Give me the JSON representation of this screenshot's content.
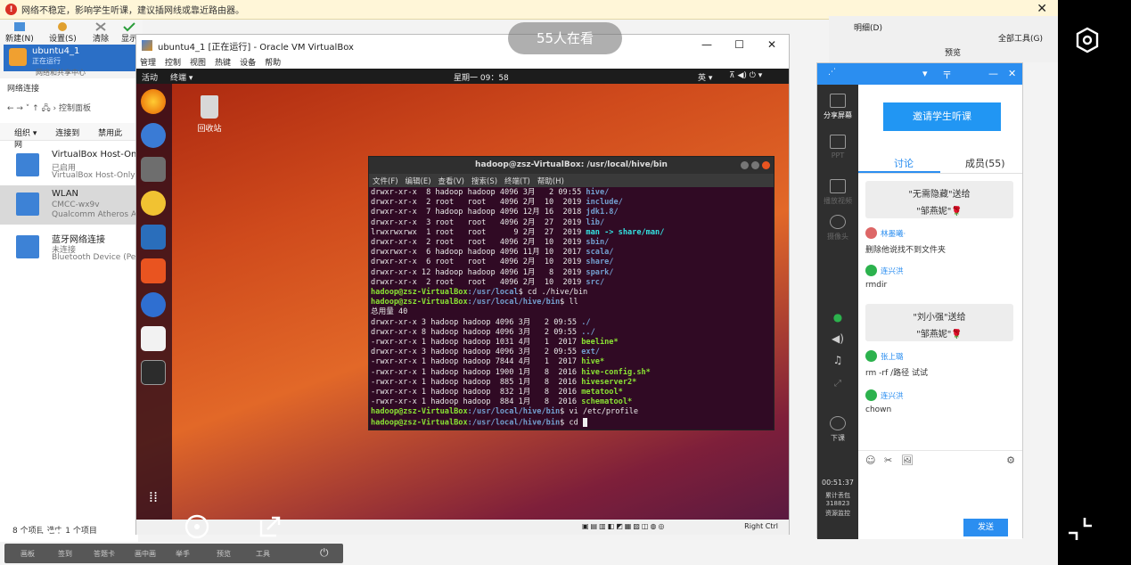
{
  "warning_bar": {
    "text": "网络不稳定，影响学生听课，建议插网线或靠近路由器。",
    "close": "✕"
  },
  "viewer_count": "55人在看",
  "vbox_manager": {
    "toolbar": [
      "新建(N)",
      "设置(S)",
      "清除",
      "显示"
    ],
    "vm_name": "ubuntu4_1",
    "vm_state": "正在运行",
    "shared_center": "网络和共享中心"
  },
  "network_panel": {
    "title": "网络连接",
    "breadcrumb": "控制面板",
    "tools": [
      "组织 ▾",
      "连接到",
      "禁用此网"
    ],
    "adapters": [
      {
        "name": "VirtualBox Host-Only",
        "line2": "已启用",
        "line3": "VirtualBox Host-Only"
      },
      {
        "name": "WLAN",
        "line2": "CMCC-wx9v",
        "line3": "Qualcomm Atheros A"
      },
      {
        "name": "蓝牙网络连接",
        "line2": "未连接",
        "line3": "Bluetooth Device (Pe"
      }
    ],
    "status": "8 个项目    选中 1 个项目"
  },
  "vm_window": {
    "title": "ubuntu4_1 [正在运行] - Oracle VM VirtualBox",
    "menu": [
      "管理",
      "控制",
      "视图",
      "热键",
      "设备",
      "帮助"
    ],
    "host_key": "Right Ctrl"
  },
  "ubuntu": {
    "activities": "活动",
    "terminal_app": "终端 ▾",
    "clock": "星期一 09：58",
    "ime": "英 ▾",
    "trash": "回收站"
  },
  "terminal": {
    "title": "hadoop@zsz-VirtualBox: /usr/local/hive/bin",
    "menu": [
      "文件(F)",
      "编辑(E)",
      "查看(V)",
      "搜索(S)",
      "终端(T)",
      "帮助(H)"
    ],
    "listing1": [
      {
        "perm": "drwxr-xr-x  8 hadoop hadoop 4096 3月   2 09:55 ",
        "name": "hive/",
        "kind": "dir"
      },
      {
        "perm": "drwxr-xr-x  2 root   root   4096 2月  10  2019 ",
        "name": "include/",
        "kind": "dir"
      },
      {
        "perm": "drwxr-xr-x  7 hadoop hadoop 4096 12月 16  2018 ",
        "name": "jdk1.8/",
        "kind": "dir"
      },
      {
        "perm": "drwxr-xr-x  3 root   root   4096 2月  27  2019 ",
        "name": "lib/",
        "kind": "dir"
      },
      {
        "perm": "lrwxrwxrwx  1 root   root      9 2月  27  2019 ",
        "name": "man -> share/man/",
        "kind": "lnk"
      },
      {
        "perm": "drwxr-xr-x  2 root   root   4096 2月  10  2019 ",
        "name": "sbin/",
        "kind": "dir"
      },
      {
        "perm": "drwxrwxr-x  6 hadoop hadoop 4096 11月 10  2017 ",
        "name": "scala/",
        "kind": "dir"
      },
      {
        "perm": "drwxr-xr-x  6 root   root   4096 2月  10  2019 ",
        "name": "share/",
        "kind": "dir"
      },
      {
        "perm": "drwxr-xr-x 12 hadoop hadoop 4096 1月   8  2019 ",
        "name": "spark/",
        "kind": "dir"
      },
      {
        "perm": "drwxr-xr-x  2 root   root   4096 2月  10  2019 ",
        "name": "src/",
        "kind": "dir"
      }
    ],
    "cmd1_prompt": "hadoop@zsz-VirtualBox",
    "cmd1_path": ":/usr/local",
    "cmd1": "$ cd ./hive/bin",
    "cmd2_path": ":/usr/local/hive/bin",
    "cmd2": "$ ll",
    "total": "总用量 40",
    "listing2": [
      {
        "perm": "drwxr-xr-x 3 hadoop hadoop 4096 3月   2 09:55 ",
        "name": "./",
        "kind": "dir"
      },
      {
        "perm": "drwxr-xr-x 8 hadoop hadoop 4096 3月   2 09:55 ",
        "name": "../",
        "kind": "dir"
      },
      {
        "perm": "-rwxr-xr-x 1 hadoop hadoop 1031 4月   1  2017 ",
        "name": "beeline*",
        "kind": "exe"
      },
      {
        "perm": "drwxr-xr-x 3 hadoop hadoop 4096 3月   2 09:55 ",
        "name": "ext/",
        "kind": "dir"
      },
      {
        "perm": "-rwxr-xr-x 1 hadoop hadoop 7844 4月   1  2017 ",
        "name": "hive*",
        "kind": "exe"
      },
      {
        "perm": "-rwxr-xr-x 1 hadoop hadoop 1900 1月   8  2016 ",
        "name": "hive-config.sh*",
        "kind": "exe"
      },
      {
        "perm": "-rwxr-xr-x 1 hadoop hadoop  885 1月   8  2016 ",
        "name": "hiveserver2*",
        "kind": "exe"
      },
      {
        "perm": "-rwxr-xr-x 1 hadoop hadoop  832 1月   8  2016 ",
        "name": "metatool*",
        "kind": "exe"
      },
      {
        "perm": "-rwxr-xr-x 1 hadoop hadoop  884 1月   8  2016 ",
        "name": "schematool*",
        "kind": "exe"
      }
    ],
    "cmd3": "$ vi /etc/profile",
    "cmd4": "$ cd "
  },
  "background_right": {
    "items": [
      "明细(D)",
      "预览",
      "全部工具(G)"
    ]
  },
  "class_panel": {
    "header_controls": [
      "▾",
      "〒",
      "—",
      "✕"
    ],
    "tools": [
      "分享屏幕",
      "PPT",
      "播放视频",
      "摄像头",
      "下课"
    ],
    "invite": "邀请学生听课",
    "tab_discuss": "讨论",
    "tab_members": "成员(55)",
    "messages": [
      {
        "type": "gift",
        "line1": "\"无需隐藏\"送给",
        "line2": "\"邹燕妮\"🌹"
      },
      {
        "type": "msg",
        "who": "林墨曦·",
        "text": "删除他说找不到文件夹"
      },
      {
        "type": "msg",
        "who": "连兴洪",
        "text": "rmdir"
      },
      {
        "type": "gift",
        "line1": "\"刘小强\"送给",
        "line2": "\"邹燕妮\"🌹"
      },
      {
        "type": "msg",
        "who": "张上璐",
        "text": "rm -rf /路径 试试"
      },
      {
        "type": "msg",
        "who": "连兴洪",
        "text": "chown"
      }
    ],
    "elapsed": "00:51:37",
    "stats_label": "累计丢包",
    "stats_value": "318823",
    "stats_tail": "资源监控",
    "send": "发送",
    "input_tools": [
      "☺",
      "✂",
      "🖼",
      "⚙"
    ]
  },
  "live_toolbar": [
    "画板",
    "签到",
    "答题卡",
    "画中画",
    "举手",
    "预览",
    "工具"
  ]
}
